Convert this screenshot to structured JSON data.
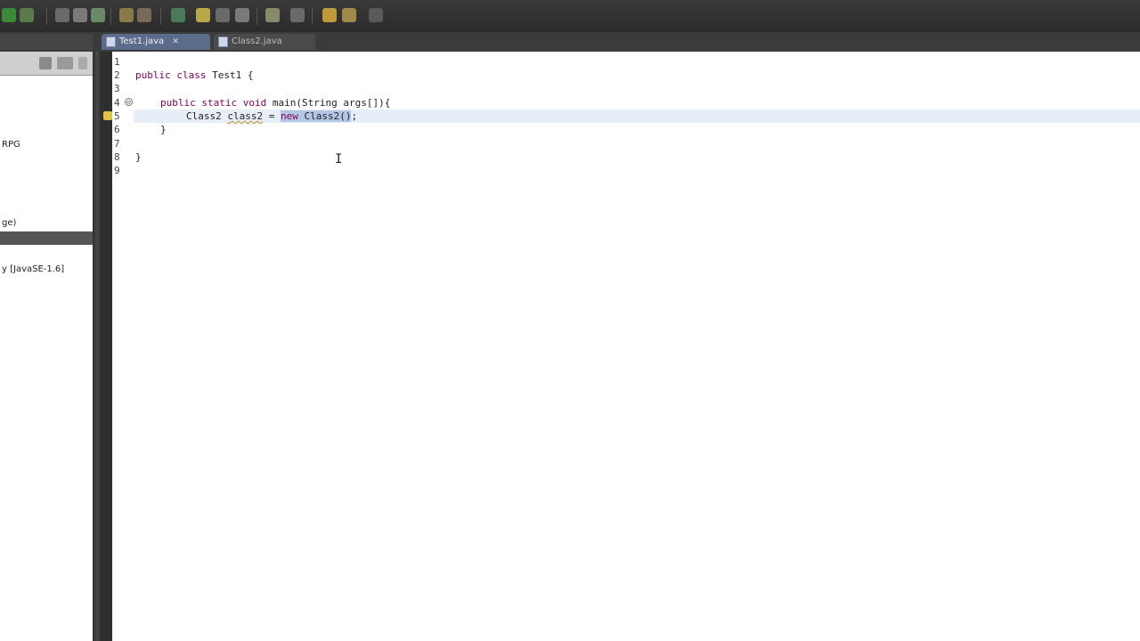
{
  "editor": {
    "tabs": [
      {
        "label": "Test1.java",
        "active": true,
        "close": "✕"
      },
      {
        "label": "Class2.java",
        "active": false
      }
    ],
    "line_numbers": [
      "1",
      "2",
      "3",
      "4",
      "5",
      "6",
      "7",
      "8",
      "9"
    ],
    "code": {
      "line2": {
        "kw1": "public",
        "kw2": "class",
        "rest": " Test1 {"
      },
      "line4": {
        "kw1": "public",
        "kw2": "static",
        "kw3": "void",
        "rest": " main(String args[]){"
      },
      "line5": {
        "type": "Class2 ",
        "var": "class2",
        "eq": " = ",
        "kw": "new",
        "call": " Class2()",
        "semi": ";"
      },
      "line6": "}",
      "line8": "}"
    },
    "fold_marker": "⊖"
  },
  "left_panel": {
    "items": [
      {
        "label": "RPG"
      },
      {
        "label": "ge)"
      },
      {
        "label": "y [JavaSE-1.6]"
      }
    ]
  },
  "colors": {
    "keyword": "#7f0055",
    "selection": "#b4c6e6",
    "current_line": "#e8eef8"
  },
  "icons": {
    "cursor": "I-beam",
    "warning": "warning-icon"
  }
}
